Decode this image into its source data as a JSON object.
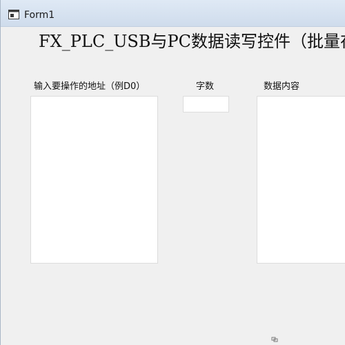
{
  "window": {
    "title": "Form1"
  },
  "main": {
    "heading": "FX_PLC_USB与PC数据读写控件（批量在"
  },
  "labels": {
    "address": "输入要操作的地址（例D0）",
    "count": "字数",
    "content": "数据内容"
  },
  "inputs": {
    "address_value": "",
    "count_value": "",
    "content_value": ""
  },
  "icons": {
    "app": "form-app-icon",
    "grip": "resize-grip-icon"
  }
}
